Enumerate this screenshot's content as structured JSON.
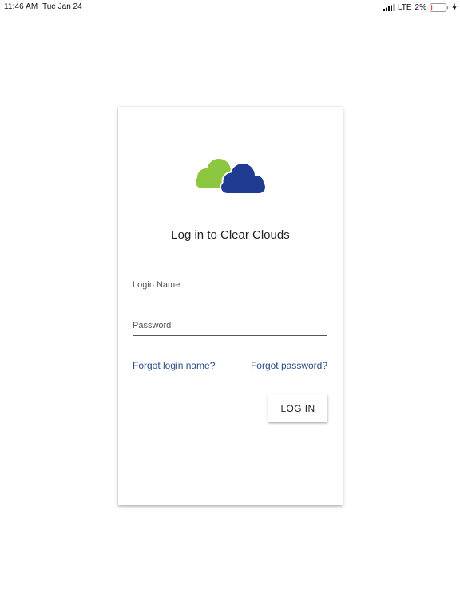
{
  "status_bar": {
    "time": "11:46 AM",
    "date": "Tue Jan 24",
    "network": "LTE",
    "battery_percent": "2%",
    "battery_level": 0.02
  },
  "icons": {
    "logo": "cloud-logo-icon",
    "signal": "cellular-signal-icon",
    "battery": "battery-icon",
    "charging": "charging-bolt-icon"
  },
  "colors": {
    "cloud_green": "#8dc63f",
    "cloud_blue": "#1f3c92",
    "link": "#2c4d8c",
    "battery_low": "#e84b3c"
  },
  "login": {
    "title": "Log in to Clear Clouds",
    "login_name_placeholder": "Login Name",
    "password_placeholder": "Password",
    "forgot_login_label": "Forgot login name?",
    "forgot_password_label": "Forgot password?",
    "login_button_label": "LOG IN"
  }
}
